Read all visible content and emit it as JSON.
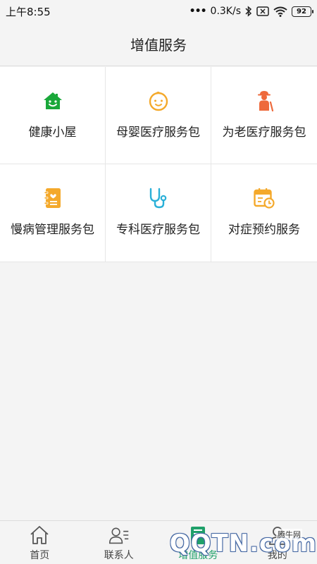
{
  "status_bar": {
    "time": "上午8:55",
    "dots": "•••",
    "net_speed": "0.3K/s",
    "battery": "92"
  },
  "header": {
    "title": "增值服务"
  },
  "services": [
    {
      "label": "健康小屋",
      "icon": "green-house-smile-icon",
      "color": "#1aa83a"
    },
    {
      "label": "母婴医疗服务包",
      "icon": "baby-face-icon",
      "color": "#f4a92b"
    },
    {
      "label": "为老医疗服务包",
      "icon": "elderly-person-icon",
      "color": "#ee6a3c"
    },
    {
      "label": "慢病管理服务包",
      "icon": "notebook-heart-icon",
      "color": "#f4a92b"
    },
    {
      "label": "专科医疗服务包",
      "icon": "stethoscope-icon",
      "color": "#2ab0d8"
    },
    {
      "label": "对症预约服务",
      "icon": "calendar-clock-icon",
      "color": "#f4a92b"
    }
  ],
  "bottom_nav": [
    {
      "label": "首页",
      "icon": "home-icon"
    },
    {
      "label": "联系人",
      "icon": "contacts-icon"
    },
    {
      "label": "增值服务",
      "icon": "services-icon",
      "active": true
    },
    {
      "label": "我的",
      "icon": "user-icon"
    }
  ],
  "watermark": {
    "brand": "QQTN.com",
    "small": "腾牛网"
  }
}
